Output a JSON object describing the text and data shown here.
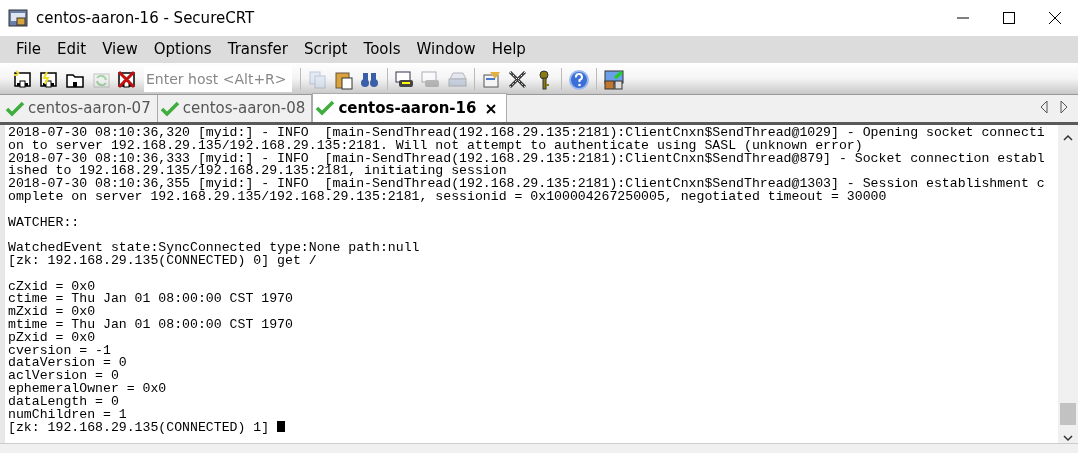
{
  "window": {
    "title": "centos-aaron-16 - SecureCRT"
  },
  "menu": [
    {
      "label": "File"
    },
    {
      "label": "Edit"
    },
    {
      "label": "View"
    },
    {
      "label": "Options"
    },
    {
      "label": "Transfer"
    },
    {
      "label": "Script"
    },
    {
      "label": "Tools"
    },
    {
      "label": "Window"
    },
    {
      "label": "Help"
    }
  ],
  "toolbar": {
    "host_field": {
      "placeholder": "Enter host <Alt+R>"
    },
    "buttons": [
      {
        "disabled": false
      },
      {
        "disabled": false
      },
      {
        "disabled": false
      },
      {
        "disabled": true
      },
      {
        "disabled": false
      },
      {
        "disabled": true
      },
      {
        "disabled": false
      },
      {
        "disabled": false
      },
      {
        "disabled": false
      },
      {
        "disabled": true
      },
      {
        "disabled": true
      },
      {
        "disabled": false
      },
      {
        "disabled": false
      },
      {
        "disabled": false
      },
      {
        "disabled": false
      },
      {
        "disabled": false
      }
    ]
  },
  "tabs": [
    {
      "label": "centos-aaron-07",
      "selected": false,
      "connected": true
    },
    {
      "label": "centos-aaron-08",
      "selected": false,
      "connected": true
    },
    {
      "label": "centos-aaron-16",
      "selected": true,
      "connected": true
    }
  ],
  "terminal": {
    "cursor": true,
    "blocks": [
      [
        "2018-07-30 08:10:36,320 [myid:] - INFO  [main-SendThread(192.168.29.135:2181):ClientCnxn$SendThread@1029] - Opening socket connecti",
        "on to server 192.168.29.135/192.168.29.135:2181. Will not attempt to authenticate using SASL (unknown error)",
        "2018-07-30 08:10:36,333 [myid:] - INFO  [main-SendThread(192.168.29.135:2181):ClientCnxn$SendThread@879] - Socket connection establ",
        "ished to 192.168.29.135/192.168.29.135:2181, initiating session",
        "2018-07-30 08:10:36,355 [myid:] - INFO  [main-SendThread(192.168.29.135:2181):ClientCnxn$SendThread@1303] - Session establishment c",
        "omplete on server 192.168.29.135/192.168.29.135:2181, sessionid = 0x100004267250005, negotiated timeout = 30000"
      ],
      [
        "WATCHER::"
      ],
      [
        "WatchedEvent state:SyncConnected type:None path:null",
        "[zk: 192.168.29.135(CONNECTED) 0] get /"
      ],
      [
        "cZxid = 0x0",
        "ctime = Thu Jan 01 08:00:00 CST 1970",
        "mZxid = 0x0",
        "mtime = Thu Jan 01 08:00:00 CST 1970",
        "pZxid = 0x0",
        "cversion = -1",
        "dataVersion = 0",
        "aclVersion = 0",
        "ephemeralOwner = 0x0",
        "dataLength = 0",
        "numChildren = 1",
        "[zk: 192.168.29.135(CONNECTED) 1]"
      ]
    ]
  }
}
